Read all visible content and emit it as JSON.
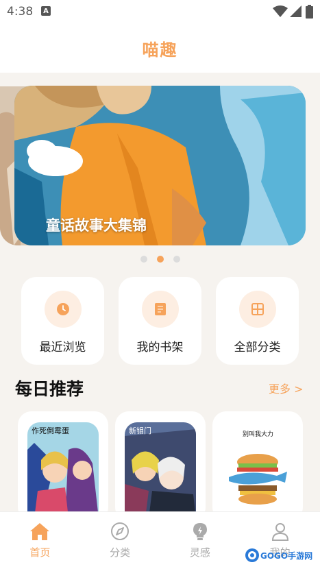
{
  "status_bar": {
    "time": "4:38",
    "notif_icon": "A"
  },
  "header": {
    "title": "喵趣"
  },
  "banner": {
    "caption": "童话故事大集锦",
    "dots": 3,
    "active_dot": 1
  },
  "entries": [
    {
      "label": "最近浏览",
      "icon": "clock-icon"
    },
    {
      "label": "我的书架",
      "icon": "book-icon"
    },
    {
      "label": "全部分类",
      "icon": "grid-icon"
    }
  ],
  "daily": {
    "title": "每日推荐",
    "more": "更多 >",
    "cards": [
      {
        "cover_title": "作死倒霉蛋"
      },
      {
        "cover_title": "新钼门"
      },
      {
        "cover_title": "别叫我大力"
      }
    ]
  },
  "tabs": [
    {
      "label": "首页",
      "icon": "home-icon",
      "active": true
    },
    {
      "label": "分类",
      "icon": "compass-icon",
      "active": false
    },
    {
      "label": "灵感",
      "icon": "bulb-icon",
      "active": false
    },
    {
      "label": "我的",
      "icon": "user-icon",
      "active": false
    }
  ],
  "watermark": {
    "text": "GOGO手游网"
  },
  "colors": {
    "accent": "#f6a35b",
    "accent_light": "#fdeee2",
    "background": "#f6f3ef"
  }
}
